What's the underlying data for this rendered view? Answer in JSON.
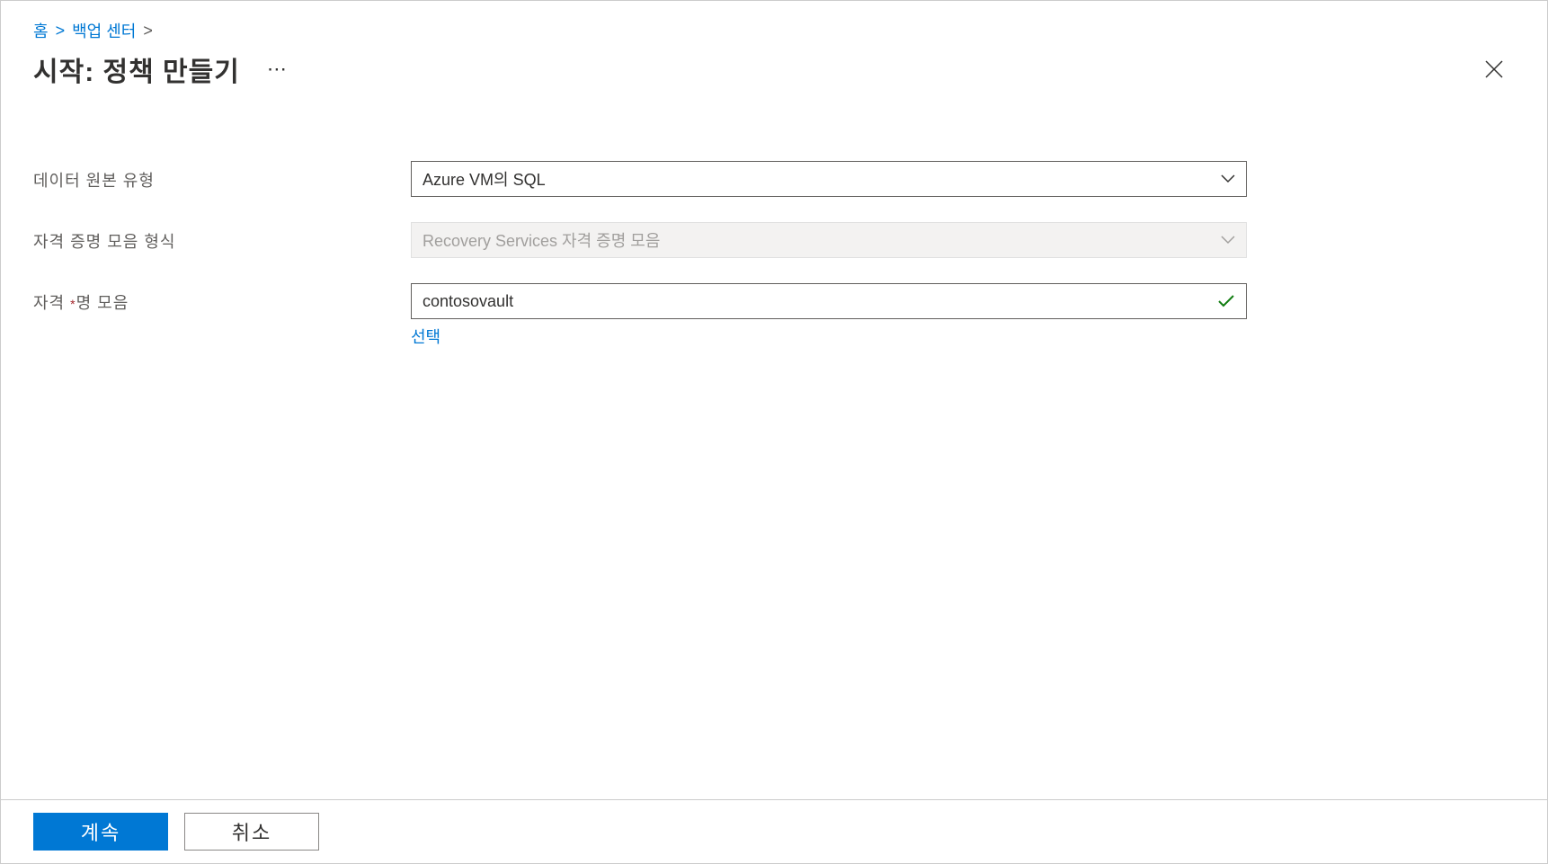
{
  "breadcrumb": {
    "home": "홈",
    "backup_center": "백업 센터"
  },
  "page": {
    "title": "시작: 정책 만들기"
  },
  "form": {
    "datasource_type": {
      "label": "데이터 원본 유형",
      "value": "Azure VM의 SQL"
    },
    "vault_type": {
      "label": "자격 증명 모음 형식",
      "value": "Recovery Services 자격 증명 모음"
    },
    "vault": {
      "label_pre": "자격 ",
      "label_post": "명 모음",
      "required_marker": "*",
      "value": "contosovault",
      "select_link": "선택"
    }
  },
  "footer": {
    "continue": "계속",
    "cancel": "취소"
  }
}
